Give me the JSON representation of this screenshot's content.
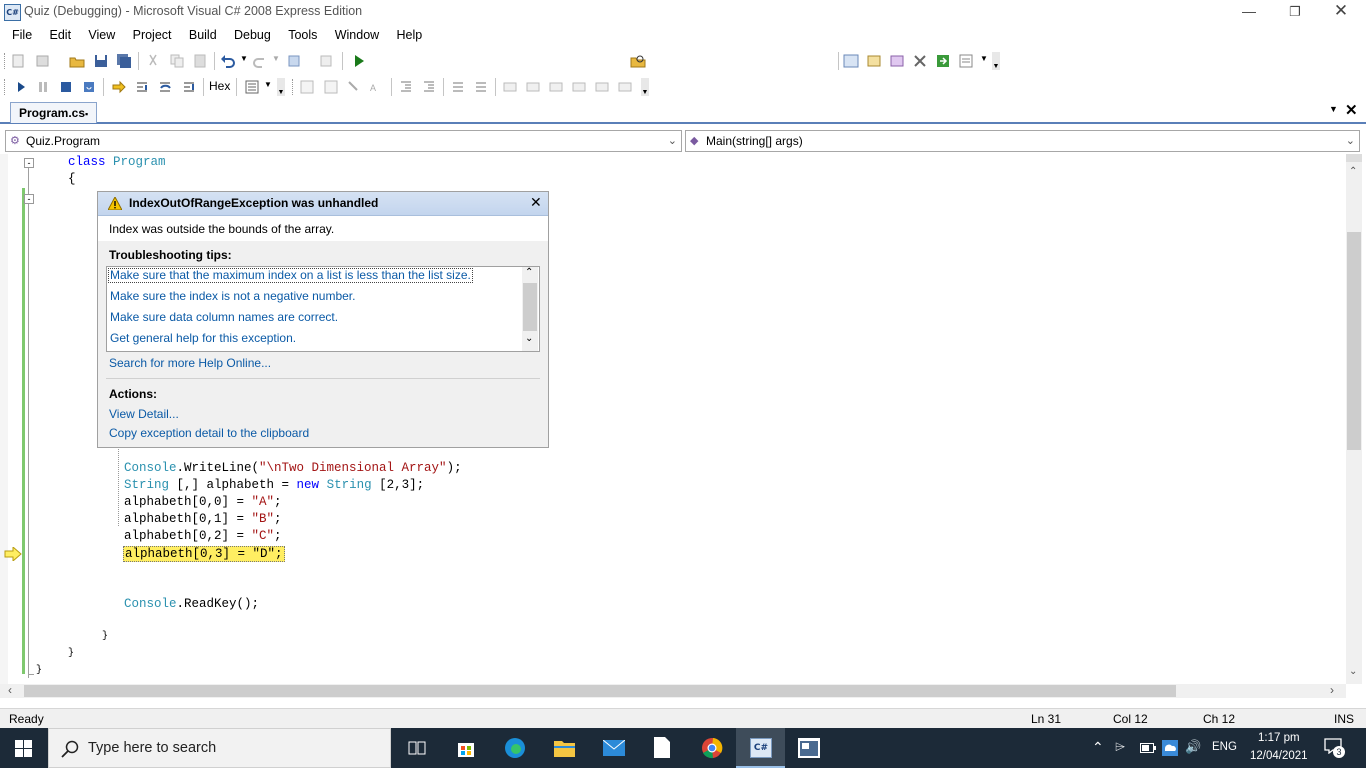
{
  "window": {
    "title": "Quiz (Debugging) - Microsoft Visual C# 2008 Express Edition",
    "app_icon": "C#",
    "controls": [
      "minimize-icon",
      "restore-icon",
      "close-icon"
    ]
  },
  "menu": [
    "File",
    "Edit",
    "View",
    "Project",
    "Build",
    "Debug",
    "Tools",
    "Window",
    "Help"
  ],
  "debug_toolbar": {
    "hex_label": "Hex"
  },
  "tab": {
    "label": "Program.cs"
  },
  "nav": {
    "type_combo": "Quiz.Program",
    "member_combo": "Main(string[] args)"
  },
  "code": {
    "l1_kw": "class",
    "l1_type": "Program",
    "l2": "{",
    "l3_type": "Console",
    "l3_a": ".WriteLine(",
    "l3_str": "\"\\nTwo Dimensional Array\"",
    "l3_b": ");",
    "l4_type": "String",
    "l4_a": " [,] alphabeth = ",
    "l4_kw": "new",
    "l4_type2": "String",
    "l4_b": " [2,3];",
    "l5_a": "alphabeth[0,0] = ",
    "l5_str": "\"A\"",
    "l5_b": ";",
    "l6_a": "alphabeth[0,1] = ",
    "l6_str": "\"B\"",
    "l6_b": ";",
    "l7_a": "alphabeth[0,2] = ",
    "l7_str": "\"C\"",
    "l7_b": ";",
    "l8": "alphabeth[0,3] = \"D\";",
    "l9_type": "Console",
    "l9_a": ".ReadKey();",
    "l10": "}",
    "l11": "}",
    "l12": "}"
  },
  "exception": {
    "title": "IndexOutOfRangeException was unhandled",
    "message": "Index was outside the bounds of the array.",
    "tips_heading": "Troubleshooting tips:",
    "tips": [
      "Make sure that the maximum index on a list is less than the list size.",
      "Make sure the index is not a negative number.",
      "Make sure data column names are correct.",
      "Get general help for this exception."
    ],
    "search_link": "Search for more Help Online...",
    "actions_heading": "Actions:",
    "actions": [
      "View Detail...",
      "Copy exception detail to the clipboard"
    ]
  },
  "status": {
    "ready": "Ready",
    "ln": "Ln 31",
    "col": "Col 12",
    "ch": "Ch 12",
    "mode": "INS"
  },
  "taskbar": {
    "search_placeholder": "Type here to search",
    "lang": "ENG",
    "time": "1:17 pm",
    "date": "12/04/2021",
    "notifications": "3"
  },
  "colors": {
    "highlight": "#ffee62",
    "accent": "#0b5aa6",
    "keyword": "#0000ff",
    "type": "#2b91af",
    "string": "#a31515"
  }
}
